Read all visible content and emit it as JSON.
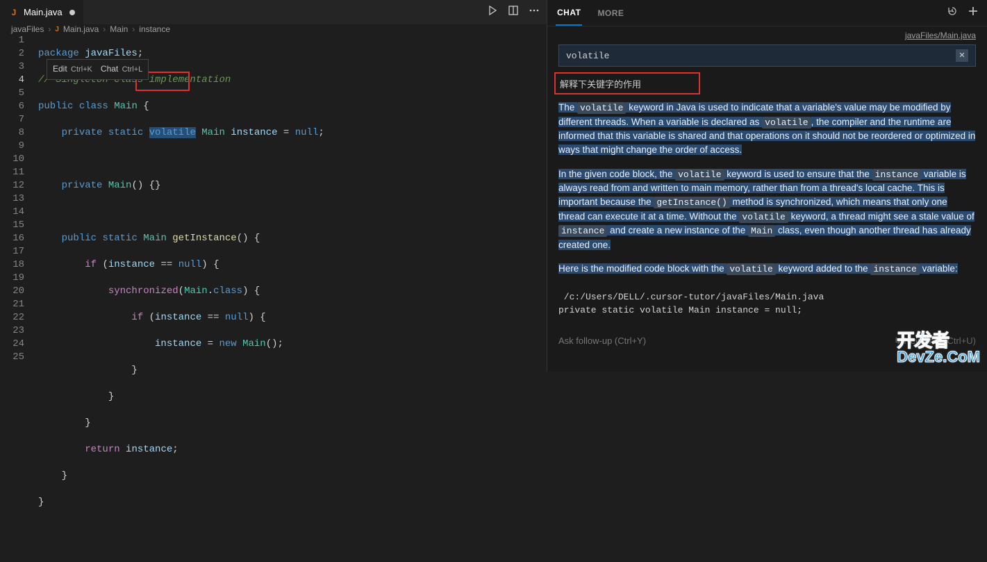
{
  "tab": {
    "filename": "Main.java",
    "iconLetter": "J"
  },
  "breadcrumb": {
    "crumb1": "javaFiles",
    "crumb2": "Main.java",
    "crumb3": "Main",
    "crumb4": "instance"
  },
  "tooltip": {
    "editLabel": "Edit",
    "editKey": "Ctrl+K",
    "chatLabel": "Chat",
    "chatKey": "Ctrl+L"
  },
  "code": {
    "lineNumbers": [
      "1",
      "2",
      "3",
      "4",
      "5",
      "6",
      "7",
      "8",
      "9",
      "10",
      "11",
      "12",
      "13",
      "14",
      "15",
      "16",
      "17",
      "18",
      "19",
      "20",
      "21",
      "22",
      "23",
      "24",
      "25"
    ],
    "activeLine": 4,
    "line1_package": "package",
    "line1_pkg": "javaFiles",
    "line2_comment": "// Singleton class implementation",
    "line3_text": "public class Main {",
    "line4_private": "private",
    "line4_static": "static",
    "line4_volatile": "volatile",
    "line4_main": "Main",
    "line4_instance": "instance",
    "line4_null": "null",
    "line6_private": "private",
    "line6_main": "Main",
    "line8_public": "public",
    "line8_static": "static",
    "line8_main": "Main",
    "line8_getinst": "getInstance",
    "line9_if": "if",
    "line9_inst": "instance",
    "line9_null": "null",
    "line10_sync": "synchronized",
    "line10_main": "Main",
    "line10_class": "class",
    "line11_if": "if",
    "line11_inst": "instance",
    "line11_null": "null",
    "line12_inst": "instance",
    "line12_new": "new",
    "line12_main": "Main",
    "line16_return": "return",
    "line16_inst": "instance"
  },
  "chat": {
    "tabChat": "CHAT",
    "tabMore": "MORE",
    "fileLink": "javaFiles/Main.java",
    "chipText": "volatile",
    "question": "解释下关键字的作用",
    "p1_t1": "The ",
    "p1_c1": "volatile",
    "p1_t2": " keyword in Java is used to indicate that a variable's value may be modified by different threads. When a variable is declared as ",
    "p1_c2": "volatile",
    "p1_t3": ", the compiler and the runtime are informed that this variable is shared and that operations on it should not be reordered or optimized in ways that might change the order of access.",
    "p2_t1": "In the given code block, the ",
    "p2_c1": "volatile",
    "p2_t2": " keyword is used to ensure that the ",
    "p2_c2": "instance",
    "p2_t3": " variable is always read from and written to main memory, rather than from a thread's local cache. This is important because the ",
    "p2_c3": "getInstance()",
    "p2_t4": " method is synchronized, which means that only one thread can execute it at a time. Without the ",
    "p2_c4": "volatile",
    "p2_t5": " keyword, a thread might see a stale value of ",
    "p2_c5": "instance",
    "p2_t6": " and create a new instance of the ",
    "p2_c6": "Main",
    "p2_t7": " class, even though another thread has already created one.",
    "p3_t1": "Here is the modified code block with the ",
    "p3_c1": "volatile",
    "p3_t2": " keyword added to the ",
    "p3_c2": "instance",
    "p3_t3": " variable:",
    "codeBlockPath": " /c:/Users/DELL/.cursor-tutor/javaFiles/Main.java",
    "codeBlockLine": "private static volatile Main instance = null;",
    "followupPlaceholder": "Ask follow-up (Ctrl+Y)",
    "newChatHint": "↳ New chat (Ctrl+U)"
  },
  "watermark": {
    "line1": "开发者",
    "line2": "DevZe.CoM"
  }
}
